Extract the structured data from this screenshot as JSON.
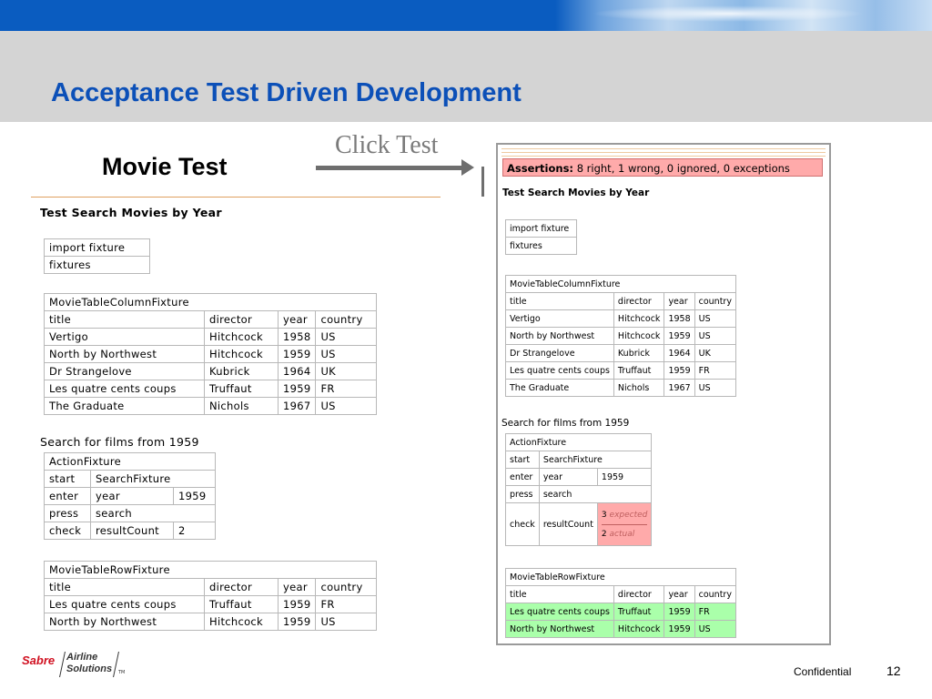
{
  "slide": {
    "title": "Acceptance Test Driven Development",
    "subtitle": "Movie Test",
    "click_label": "Click Test",
    "footer": {
      "confidential": "Confidential",
      "page": "12"
    },
    "logo": {
      "brand": "Sabre",
      "line1": "Airline",
      "line2": "Solutions",
      "tm": "TM"
    }
  },
  "left": {
    "heading": "Test Search Movies by Year",
    "import_rows": [
      "import fixture",
      "fixtures"
    ],
    "column_fixture": {
      "name": "MovieTableColumnFixture",
      "headers": [
        "title",
        "director",
        "year",
        "country"
      ],
      "rows": [
        [
          "Vertigo",
          "Hitchcock",
          "1958",
          "US"
        ],
        [
          "North by Northwest",
          "Hitchcock",
          "1959",
          "US"
        ],
        [
          "Dr Strangelove",
          "Kubrick",
          "1964",
          "UK"
        ],
        [
          "Les quatre cents coups",
          "Truffaut",
          "1959",
          "FR"
        ],
        [
          "The Graduate",
          "Nichols",
          "1967",
          "US"
        ]
      ]
    },
    "search_heading": "Search for films from 1959",
    "action_fixture": {
      "name": "ActionFixture",
      "rows": [
        [
          "start",
          "SearchFixture",
          ""
        ],
        [
          "enter",
          "year",
          "1959"
        ],
        [
          "press",
          "search",
          ""
        ],
        [
          "check",
          "resultCount",
          "2"
        ]
      ]
    },
    "row_fixture": {
      "name": "MovieTableRowFixture",
      "headers": [
        "title",
        "director",
        "year",
        "country"
      ],
      "rows": [
        [
          "Les quatre cents coups",
          "Truffaut",
          "1959",
          "FR"
        ],
        [
          "North by Northwest",
          "Hitchcock",
          "1959",
          "US"
        ]
      ]
    }
  },
  "right": {
    "assertions_label": "Assertions:",
    "assertions_text": "8 right, 1 wrong, 0 ignored, 0 exceptions",
    "heading": "Test Search Movies by Year",
    "import_rows": [
      "import fixture",
      "fixtures"
    ],
    "column_fixture": {
      "name": "MovieTableColumnFixture",
      "headers": [
        "title",
        "director",
        "year",
        "country"
      ],
      "rows": [
        [
          "Vertigo",
          "Hitchcock",
          "1958",
          "US"
        ],
        [
          "North by Northwest",
          "Hitchcock",
          "1959",
          "US"
        ],
        [
          "Dr Strangelove",
          "Kubrick",
          "1964",
          "UK"
        ],
        [
          "Les quatre cents coups",
          "Truffaut",
          "1959",
          "FR"
        ],
        [
          "The Graduate",
          "Nichols",
          "1967",
          "US"
        ]
      ]
    },
    "search_heading": "Search for films from 1959",
    "action_fixture": {
      "name": "ActionFixture",
      "rows": [
        [
          "start",
          "SearchFixture",
          ""
        ],
        [
          "enter",
          "year",
          "1959"
        ],
        [
          "press",
          "search",
          ""
        ]
      ],
      "check": {
        "label": "check",
        "field": "resultCount",
        "expected_value": "3",
        "expected_word": "expected",
        "actual_value": "2",
        "actual_word": "actual"
      }
    },
    "row_fixture": {
      "name": "MovieTableRowFixture",
      "headers": [
        "title",
        "director",
        "year",
        "country"
      ],
      "rows": [
        [
          "Les quatre cents coups",
          "Truffaut",
          "1959",
          "FR"
        ],
        [
          "North by Northwest",
          "Hitchcock",
          "1959",
          "US"
        ]
      ]
    }
  },
  "colors": {
    "title_blue": "#0c50b8",
    "pass_green": "#aaffaa",
    "fail_red": "#ffaaaa",
    "header_gray": "#d4d4d4"
  }
}
